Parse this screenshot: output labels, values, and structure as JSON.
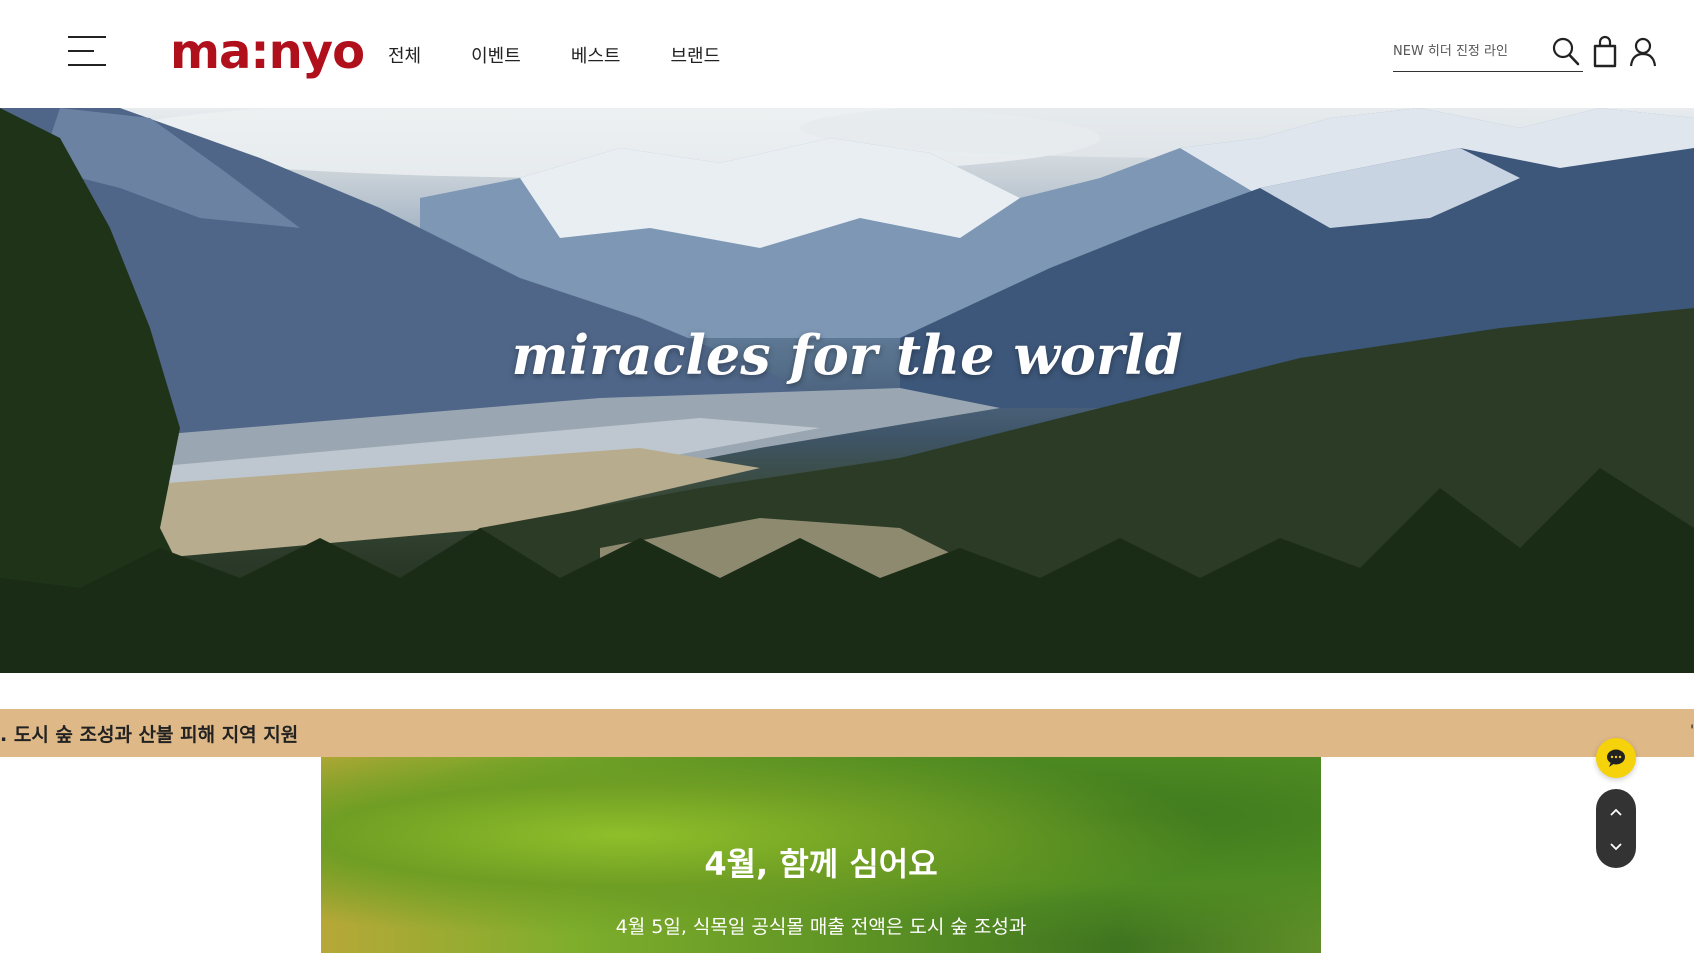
{
  "header": {
    "logo_text": "ma:nyo",
    "nav": [
      {
        "label": "전체"
      },
      {
        "label": "이벤트"
      },
      {
        "label": "베스트"
      },
      {
        "label": "브랜드"
      }
    ],
    "search": {
      "placeholder": "NEW 히더 진정 라인"
    }
  },
  "hero": {
    "tagline": "miracles for the world"
  },
  "ticker": {
    "text": ". 도시 숲 조성과 산불 피해 지역 지원",
    "edge_glyph": "'"
  },
  "card": {
    "title": "4월, 함께 심어요",
    "body": "4월 5일, 식목일 공식몰 매출 전액은 도시 숲 조성과"
  },
  "colors": {
    "brand": "#b0101c",
    "ticker_bg": "#deb887",
    "chat_button": "#f5d20a",
    "scroll_control": "#333333"
  },
  "icons": [
    "menu-icon",
    "search-icon",
    "shopping-bag-icon",
    "user-icon",
    "chat-icon",
    "chevron-up-icon",
    "chevron-down-icon"
  ]
}
